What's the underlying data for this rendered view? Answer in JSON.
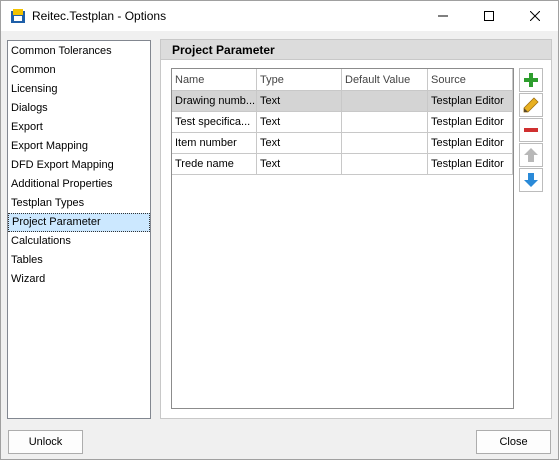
{
  "window": {
    "title": "Reitec.Testplan - Options"
  },
  "nav": {
    "items": [
      {
        "label": "Common Tolerances",
        "selected": false
      },
      {
        "label": "Common",
        "selected": false
      },
      {
        "label": "Licensing",
        "selected": false
      },
      {
        "label": "Dialogs",
        "selected": false
      },
      {
        "label": "Export",
        "selected": false
      },
      {
        "label": "Export Mapping",
        "selected": false
      },
      {
        "label": "DFD Export Mapping",
        "selected": false
      },
      {
        "label": "Additional Properties",
        "selected": false
      },
      {
        "label": "Testplan Types",
        "selected": false
      },
      {
        "label": "Project Parameter",
        "selected": true
      },
      {
        "label": "Calculations",
        "selected": false
      },
      {
        "label": "Tables",
        "selected": false
      },
      {
        "label": "Wizard",
        "selected": false
      }
    ]
  },
  "panel": {
    "title": "Project Parameter",
    "columns": [
      "Name",
      "Type",
      "Default Value",
      "Source"
    ],
    "rows": [
      {
        "name": "Drawing numb...",
        "type": "Text",
        "default": "",
        "source": "Testplan Editor",
        "selected": true
      },
      {
        "name": "Test specifica...",
        "type": "Text",
        "default": "",
        "source": "Testplan Editor",
        "selected": false
      },
      {
        "name": "Item number",
        "type": "Text",
        "default": "",
        "source": "Testplan Editor",
        "selected": false
      },
      {
        "name": "Trede name",
        "type": "Text",
        "default": "",
        "source": "Testplan Editor",
        "selected": false
      }
    ],
    "actions": [
      {
        "icon": "plus-icon",
        "color": "#2e9e2e"
      },
      {
        "icon": "pencil-icon",
        "color": "#e8b020"
      },
      {
        "icon": "minus-icon",
        "color": "#d03030"
      },
      {
        "icon": "arrow-up-icon",
        "color": "#b8b8b8"
      },
      {
        "icon": "arrow-down-icon",
        "color": "#2a8ad8"
      }
    ]
  },
  "footer": {
    "unlock_label": "Unlock",
    "close_label": "Close"
  }
}
